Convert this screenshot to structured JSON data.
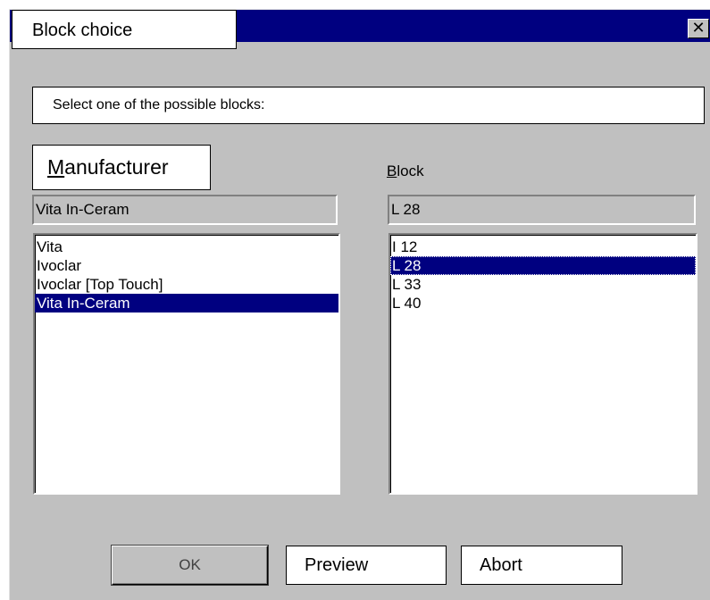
{
  "window": {
    "title": "Block choice",
    "close_symbol": "✕"
  },
  "prompt": "Select one of the possible blocks:",
  "manufacturer": {
    "label_accel": "M",
    "label_rest": "anufacturer",
    "selected_value": "Vita In-Ceram",
    "items": [
      {
        "label": "Vita",
        "selected": false
      },
      {
        "label": "Ivoclar",
        "selected": false
      },
      {
        "label": "Ivoclar [Top Touch]",
        "selected": false
      },
      {
        "label": "Vita In-Ceram",
        "selected": true
      }
    ]
  },
  "block": {
    "label_accel": "B",
    "label_rest": "lock",
    "selected_value": "L 28",
    "items": [
      {
        "label": "I 12",
        "selected": false
      },
      {
        "label": "L 28",
        "selected": true
      },
      {
        "label": "L 33",
        "selected": false
      },
      {
        "label": "L 40",
        "selected": false
      }
    ]
  },
  "buttons": {
    "ok": "OK",
    "preview": "Preview",
    "abort": "Abort"
  },
  "colors": {
    "dialog_bg": "#c0c0c0",
    "titlebar": "#000080",
    "selection": "#000080"
  }
}
